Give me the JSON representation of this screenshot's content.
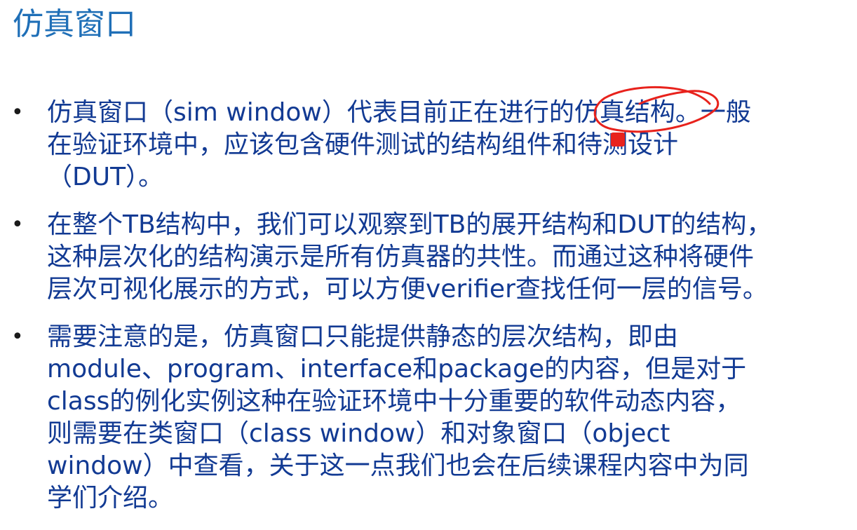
{
  "title": "仿真窗口",
  "bullet_symbol": "•",
  "bullets": [
    {
      "lines": [
        "仿真窗口（sim window）代表目前正在进行的仿真结构。一般",
        "在验证环境中，应该包含硬件测试的结构组件和待测设计",
        "（DUT）。"
      ]
    },
    {
      "lines": [
        "在整个TB结构中，我们可以观察到TB的展开结构和DUT的结构，",
        "这种层次化的结构演示是所有仿真器的共性。而通过这种将硬件",
        "层次可视化展示的方式，可以方便verifier查找任何一层的信号。"
      ]
    },
    {
      "lines": [
        "需要注意的是，仿真窗口只能提供静态的层次结构，即由",
        "module、program、interface和package的内容，但是对于",
        "class的例化实例这种在验证环境中十分重要的软件动态内容，",
        "则需要在类窗口（class window）和对象窗口（object",
        "window）中查看，关于这一点我们也会在后续课程内容中为同",
        "学们介绍。"
      ]
    }
  ],
  "colors": {
    "title": "#1f6fb7",
    "body_text": "#123a93",
    "bullet": "#1a1a1a",
    "annotation_ink": "#e8221c",
    "background": "#ffffff"
  }
}
